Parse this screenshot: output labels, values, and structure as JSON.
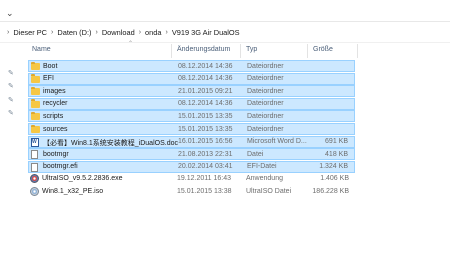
{
  "toolbar": {
    "expand_glyph": "⌄"
  },
  "breadcrumb": {
    "items": [
      "Dieser PC",
      "Daten (D:)",
      "Download",
      "onda",
      "V919 3G Air DualOS"
    ],
    "separator": "›"
  },
  "columns": {
    "name": "Name",
    "date": "Änderungsdatum",
    "type": "Typ",
    "size": "Größe"
  },
  "quick_access_pins": [
    "pin-icon",
    "pin-icon",
    "pin-icon",
    "pin-icon"
  ],
  "files": [
    {
      "name": "Boot",
      "date": "08.12.2014 14:36",
      "type": "Dateiordner",
      "size": "",
      "icon": "folder-icon",
      "selected": true
    },
    {
      "name": "EFI",
      "date": "08.12.2014 14:36",
      "type": "Dateiordner",
      "size": "",
      "icon": "folder-icon",
      "selected": true
    },
    {
      "name": "images",
      "date": "21.01.2015 09:21",
      "type": "Dateiordner",
      "size": "",
      "icon": "folder-icon",
      "selected": true
    },
    {
      "name": "recycler",
      "date": "08.12.2014 14:36",
      "type": "Dateiordner",
      "size": "",
      "icon": "folder-icon",
      "selected": true
    },
    {
      "name": "scripts",
      "date": "15.01.2015 13:35",
      "type": "Dateiordner",
      "size": "",
      "icon": "folder-icon",
      "selected": true
    },
    {
      "name": "sources",
      "date": "15.01.2015 13:35",
      "type": "Dateiordner",
      "size": "",
      "icon": "folder-icon",
      "selected": true
    },
    {
      "name": "【必看】Win8.1系统安装教程_iDualOS.doc",
      "date": "16.01.2015 16:56",
      "type": "Microsoft Word D...",
      "size": "691 KB",
      "icon": "word-doc-icon",
      "selected": true
    },
    {
      "name": "bootmgr",
      "date": "21.08.2013 22:31",
      "type": "Datei",
      "size": "418 KB",
      "icon": "file-icon",
      "selected": true
    },
    {
      "name": "bootmgr.efi",
      "date": "20.02.2014 03:41",
      "type": "EFI-Datei",
      "size": "1.324 KB",
      "icon": "efi-file-icon",
      "selected": true
    },
    {
      "name": "UltraISO_v9.5.2.2836.exe",
      "date": "19.12.2011 16:43",
      "type": "Anwendung",
      "size": "1.406 KB",
      "icon": "ultraiso-exe-icon",
      "selected": false
    },
    {
      "name": "Win8.1_x32_PE.iso",
      "date": "15.01.2015 13:38",
      "type": "UltraISO Datei",
      "size": "186.228 KB",
      "icon": "iso-disc-icon",
      "selected": false
    }
  ]
}
